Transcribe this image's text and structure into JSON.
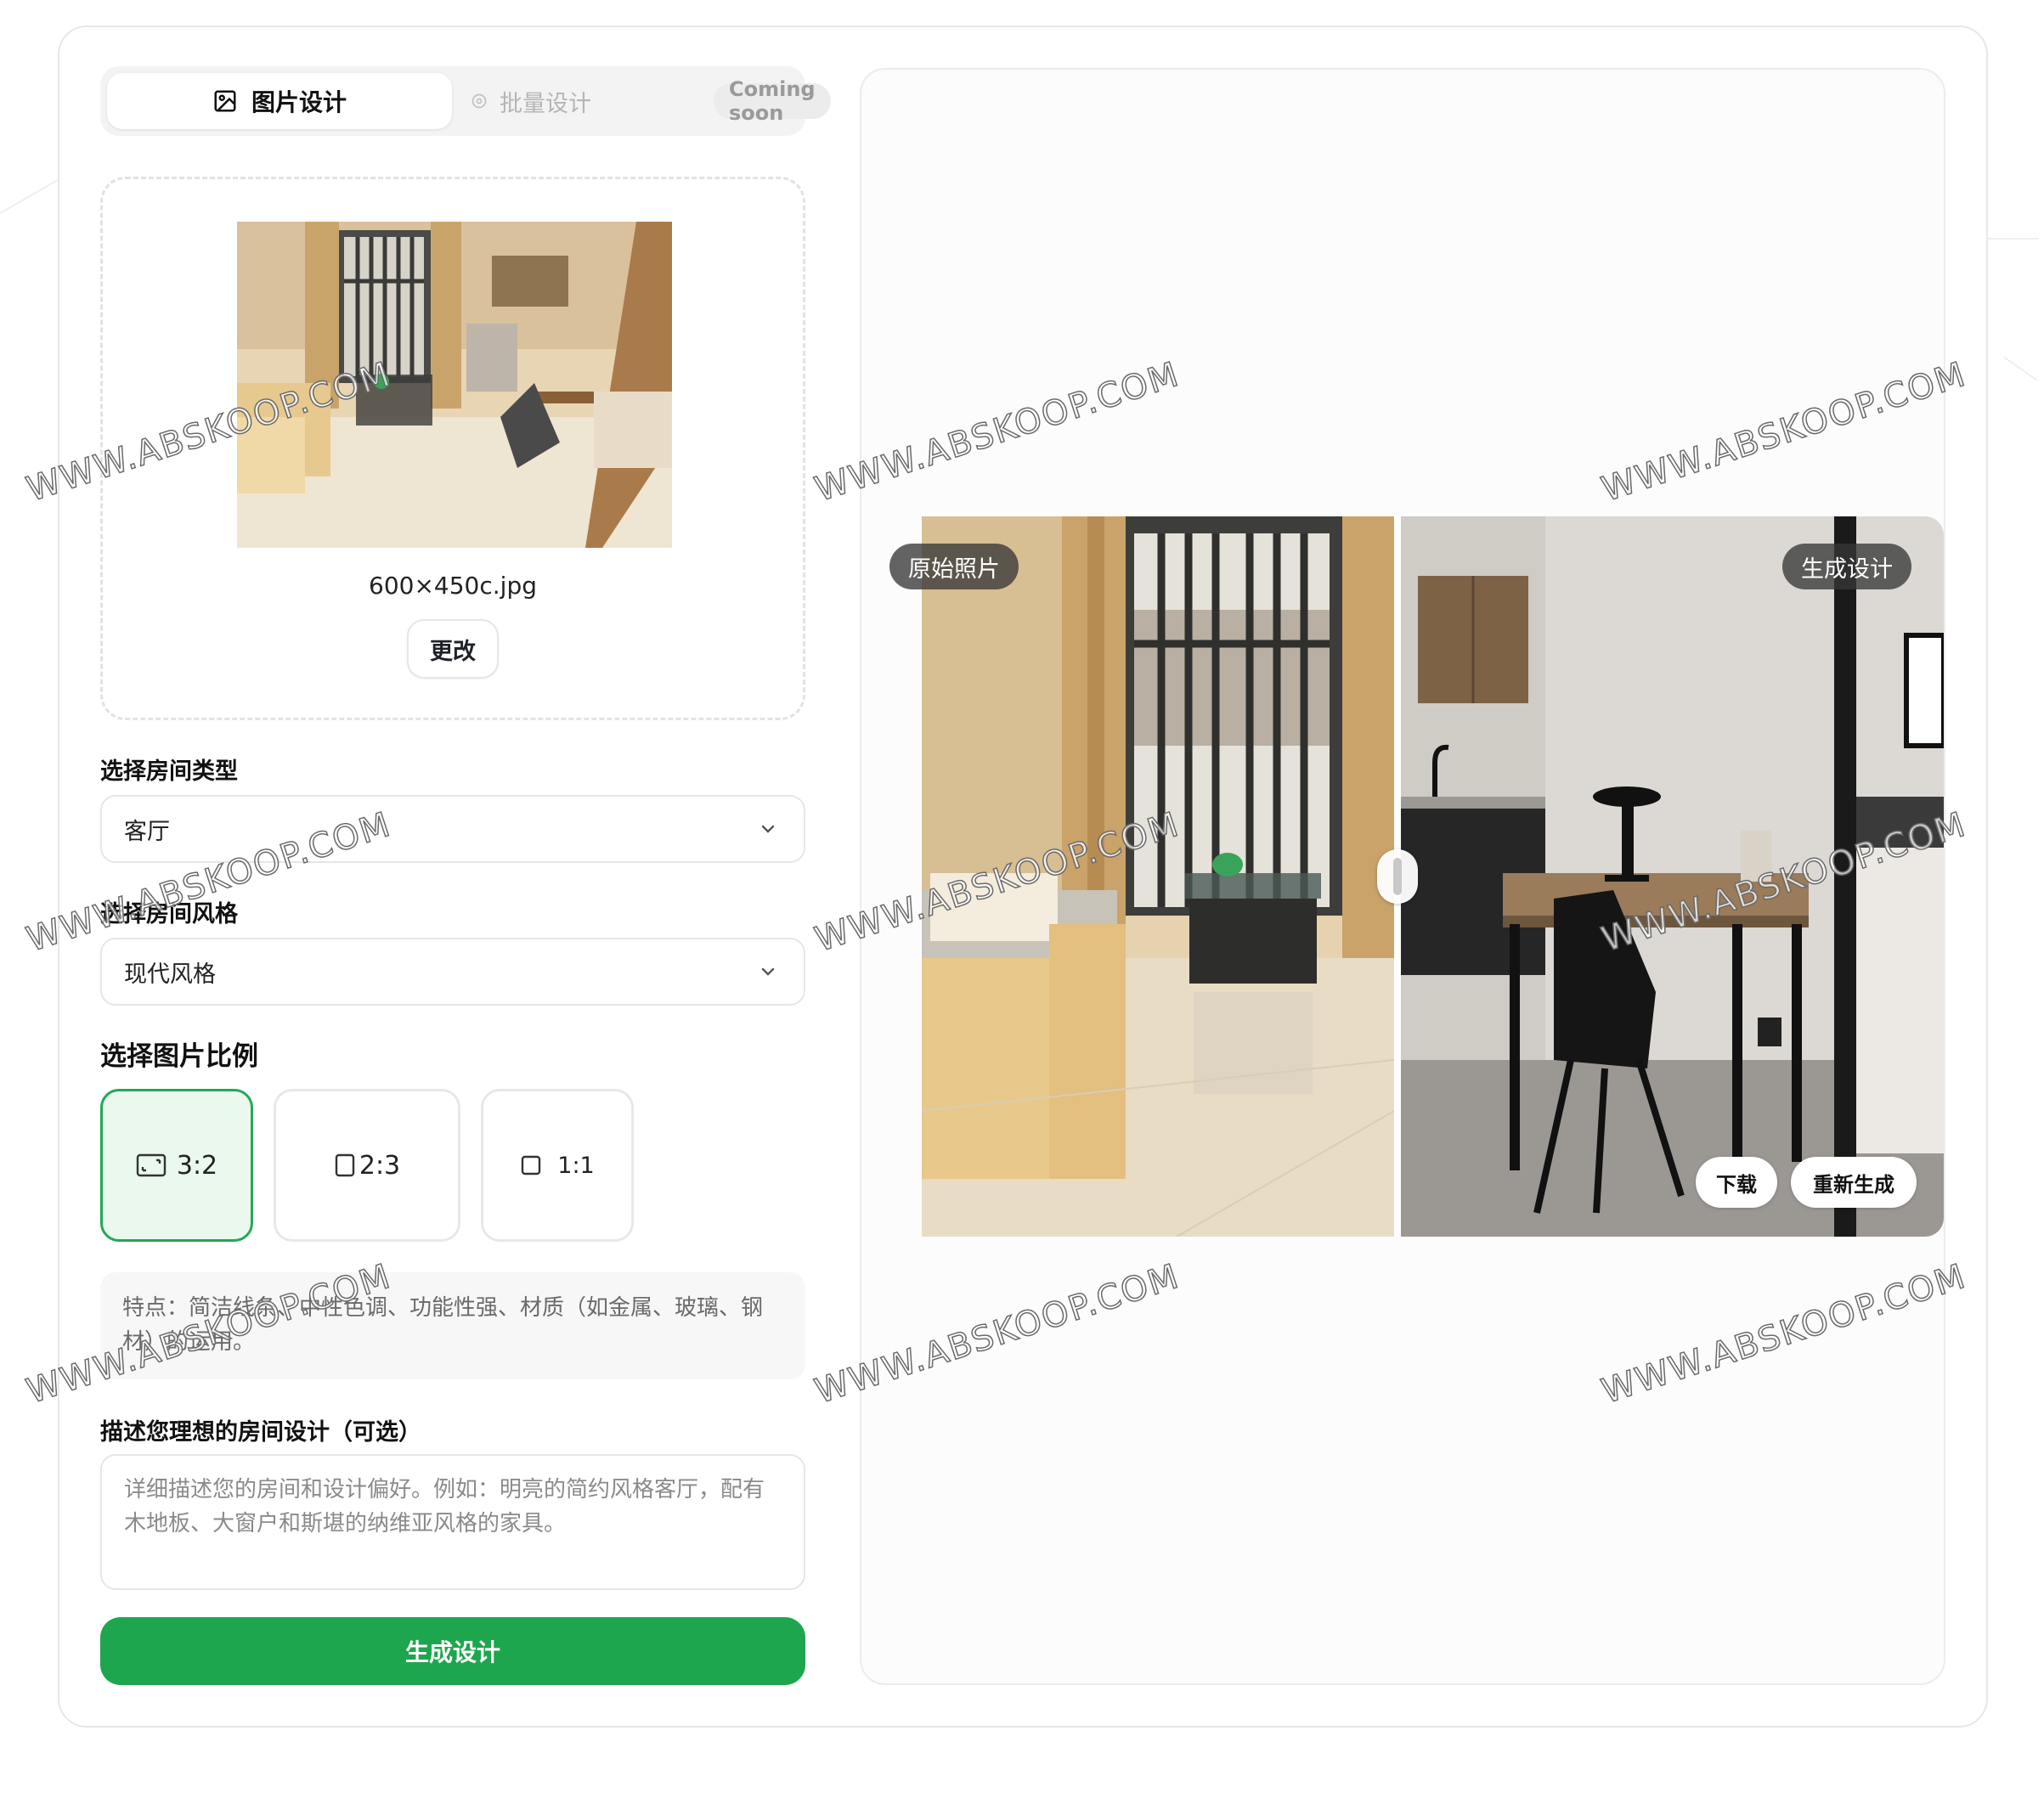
{
  "tabs": {
    "image_design_label": "图片设计",
    "batch_design_label": "批量设计",
    "coming_soon_label": "Coming soon"
  },
  "upload": {
    "file_name": "600×450c.jpg",
    "change_label": "更改"
  },
  "room_type": {
    "label": "选择房间类型",
    "value": "客厅"
  },
  "room_style": {
    "label": "选择房间风格",
    "value": "现代风格"
  },
  "ratio": {
    "title": "选择图片比例",
    "options": [
      {
        "label": "3:2",
        "selected": true
      },
      {
        "label": "2:3",
        "selected": false
      },
      {
        "label": "1:1",
        "selected": false
      }
    ]
  },
  "style_description": "特点：简洁线条、中性色调、功能性强、材质（如金属、玻璃、钢材）的运用。",
  "prompt": {
    "label": "描述您理想的房间设计（可选）",
    "placeholder": "详细描述您的房间和设计偏好。例如：明亮的简约风格客厅，配有木地板、大窗户和斯堪的纳维亚风格的家具。"
  },
  "generate_label": "生成设计",
  "preview": {
    "original_label": "原始照片",
    "generated_label": "生成设计",
    "download_label": "下载",
    "regenerate_label": "重新生成"
  },
  "watermark_text": "WWW.ABSKOOP.COM",
  "colors": {
    "accent_green": "#1ea64e",
    "selected_bg": "#eaf8ee"
  }
}
